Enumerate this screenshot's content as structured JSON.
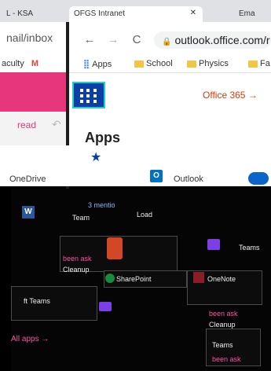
{
  "browser": {
    "tabs": [
      "L - KSA",
      "OFGS Intranet",
      "Ema"
    ],
    "url": "outlook.office.com/r",
    "left_url": "nail/inbox",
    "bookmarks": [
      "Apps",
      "School",
      "Physics",
      "Fa"
    ],
    "left_bookmarks": "aculty",
    "nav": {
      "back": "←",
      "forward": "→",
      "reload": "C",
      "lock": "🔒"
    }
  },
  "office": {
    "brand": "Office 365",
    "arrow": "→",
    "apps_heading": "Apps"
  },
  "left_panel": {
    "read_label": "read",
    "undo": "↶"
  },
  "apps_row": {
    "onedrive": "OneDrive",
    "outlook": "Outlook",
    "outlook_letter": "O"
  },
  "tiles": {
    "t1": "Team",
    "t1b": "Load",
    "mention": "3 mentio",
    "p1": "been ask",
    "p2": "Cleanup",
    "teams": "Teams",
    "bottom_left": "ft Teams",
    "sharepoint": "SharePoint",
    "onenote": "OneNote",
    "p3": "been ask",
    "p4": "Cleanup",
    "all_apps": "All apps",
    "all_apps_arrow": "→",
    "p5": "Teams",
    "p6": "been ask"
  },
  "colors": {
    "accent_pink": "#e8367a",
    "office_orange": "#d83b01",
    "waffle_bg": "#0b3ea6",
    "waffle_outline": "#20d0c0"
  },
  "icons": [
    "waffle-icon",
    "star-icon",
    "folder-icon",
    "lock-icon",
    "cloud-icon",
    "undo-icon"
  ]
}
